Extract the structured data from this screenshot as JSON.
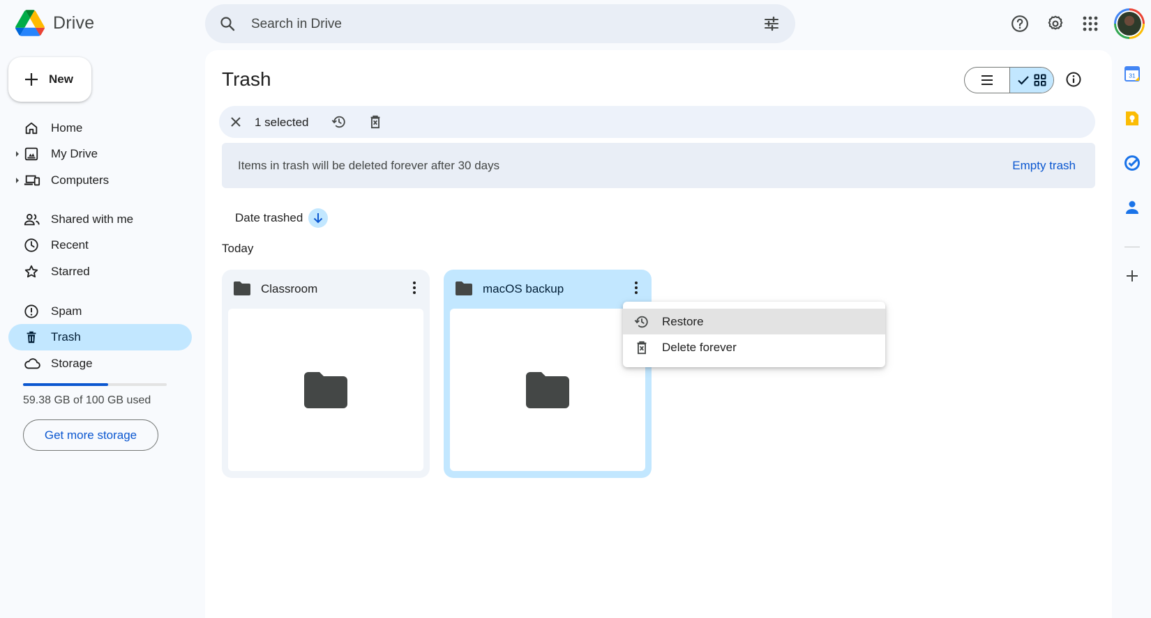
{
  "app": {
    "name": "Drive",
    "search_placeholder": "Search in Drive"
  },
  "toolbar_icons": [
    "search-icon",
    "search-options-icon",
    "help-icon",
    "settings-icon",
    "apps-grid-icon",
    "account-avatar"
  ],
  "sidebar": {
    "new_label": "New",
    "items": [
      {
        "label": "Home",
        "icon": "home-icon",
        "expandable": false
      },
      {
        "label": "My Drive",
        "icon": "my-drive-icon",
        "expandable": true
      },
      {
        "label": "Computers",
        "icon": "computers-icon",
        "expandable": true
      },
      {
        "label": "Shared with me",
        "icon": "shared-icon",
        "expandable": false
      },
      {
        "label": "Recent",
        "icon": "clock-icon",
        "expandable": false
      },
      {
        "label": "Starred",
        "icon": "star-icon",
        "expandable": false
      },
      {
        "label": "Spam",
        "icon": "spam-icon",
        "expandable": false
      },
      {
        "label": "Trash",
        "icon": "trash-icon",
        "expandable": false,
        "active": true
      },
      {
        "label": "Storage",
        "icon": "cloud-icon",
        "expandable": false
      }
    ],
    "storage": {
      "used_text": "59.38 GB of 100 GB used",
      "used_fraction": 0.5938,
      "button_label": "Get more storage"
    }
  },
  "main": {
    "title": "Trash",
    "view_mode": "grid",
    "selection": {
      "count_label": "1 selected"
    },
    "notice": {
      "message": "Items in trash will be deleted forever after 30 days",
      "action_label": "Empty trash"
    },
    "sort": {
      "label": "Date trashed",
      "direction": "descending"
    },
    "section_label": "Today",
    "items": [
      {
        "name": "Classroom",
        "type": "folder",
        "selected": false
      },
      {
        "name": "macOS backup",
        "type": "folder",
        "selected": true
      }
    ],
    "context_menu": {
      "items": [
        {
          "label": "Restore",
          "icon": "restore-icon",
          "highlighted": true
        },
        {
          "label": "Delete forever",
          "icon": "delete-forever-icon",
          "highlighted": false
        }
      ]
    }
  },
  "side_panel": {
    "apps": [
      "calendar-icon",
      "keep-icon",
      "tasks-icon",
      "contacts-icon",
      "add-icon"
    ],
    "calendar_day": "31"
  },
  "colors": {
    "accent": "#0b57d0",
    "selected_bg": "#c2e7ff",
    "page_bg": "#f8fafd",
    "surface": "#ffffff"
  }
}
